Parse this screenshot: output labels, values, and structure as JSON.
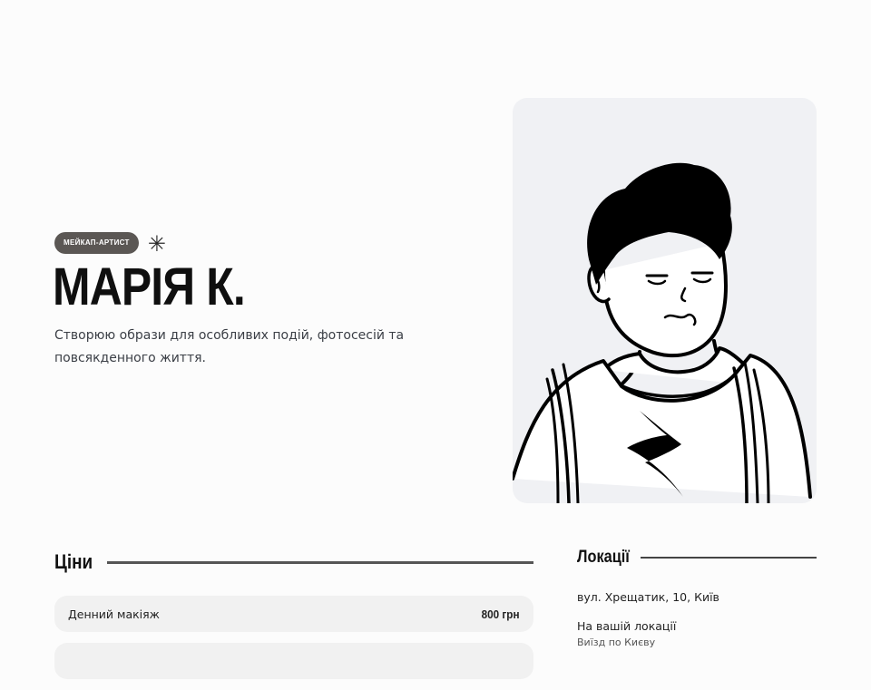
{
  "hero": {
    "badge": "МЕЙКАП-АРТИСТ",
    "ornament": "✳",
    "name": "МАРІЯ К.",
    "tagline": "Створюю образи для особливих подій, фотосесій та повсякденного життя."
  },
  "portrait": {
    "icon": "cartoon-portrait-illustration"
  },
  "prices": {
    "title": "Ціни",
    "items": [
      {
        "name": "Денний макіяж",
        "price": "800 грн"
      },
      {
        "name": "",
        "price": ""
      }
    ]
  },
  "locations": {
    "title": "Локації",
    "items": [
      {
        "title": "вул. Хрещатик, 10, Київ",
        "subtitle": ""
      },
      {
        "title": "На вашій локації",
        "subtitle": "Виїзд по Києву"
      }
    ]
  }
}
